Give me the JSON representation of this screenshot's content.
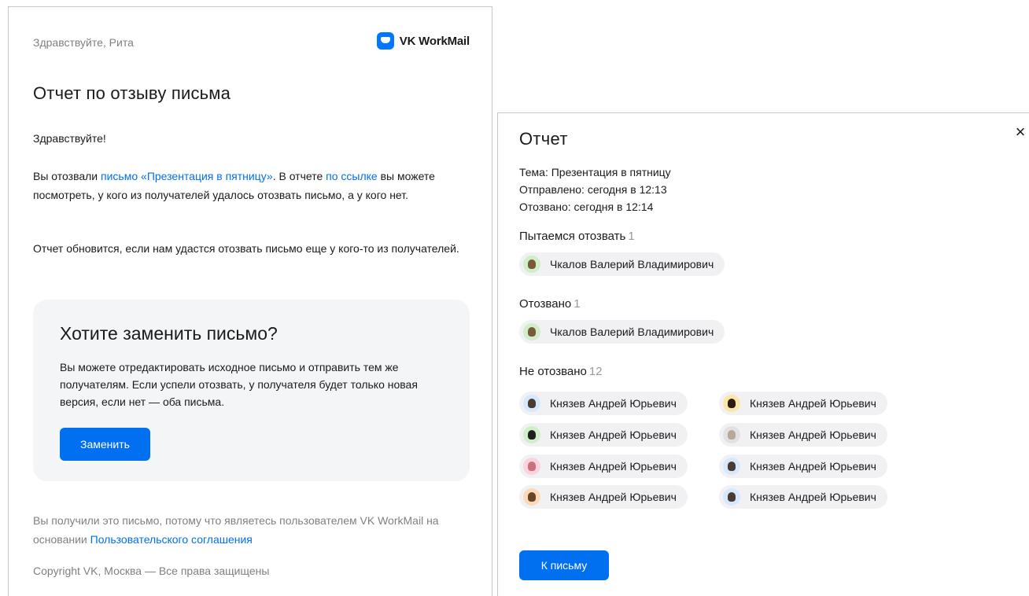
{
  "email": {
    "greeting_top": "Здравствуйте, Рита",
    "brand_name": "VK WorkMail",
    "title": "Отчет по отзыву письма",
    "hello": "Здравствуйте!",
    "para1_prefix": "Вы отозвали ",
    "para1_link": "письмо «Презентация в пятницу»",
    "para1_mid": ". В отчете ",
    "para1_link2": "по ссылке",
    "para1_suffix": " вы можете посмотреть, у кого из получателей удалось отозвать письмо, а у кого нет.",
    "para2": "Отчет обновится, если нам удастся отозвать письмо еще у кого-то из получателей.",
    "replace_card": {
      "title": "Хотите заменить письмо?",
      "text": "Вы можете отредактировать исходное письмо и отправить тем же получателям. Если успели отозвать, у получателя будет только новая версия, если нет — оба письма.",
      "button": "Заменить"
    },
    "footer_prefix": "Вы получили это письмо, потому что являетесь пользователем VK WorkMail на основании ",
    "footer_link": "Пользовательского соглашения",
    "copyright": "Copyright VK, Москва — Все права защищены"
  },
  "report": {
    "title": "Отчет",
    "close_icon": "×",
    "subject": "Тема: Презентация в пятницу",
    "sent": "Отправлено: сегодня в 12:13",
    "recalled_at": "Отозвано: сегодня в 12:14",
    "sections": [
      {
        "label": "Пытаемся отозвать",
        "count": "1",
        "people": [
          {
            "name": "Чкалов Валерий Владимирович",
            "avatar": "av-green"
          }
        ]
      },
      {
        "label": "Отозвано",
        "count": "1",
        "people": [
          {
            "name": "Чкалов Валерий Владимирович",
            "avatar": "av-green"
          }
        ]
      },
      {
        "label": "Не отозвано",
        "count": "12",
        "people": [
          {
            "name": "Князев Андрей Юрьевич",
            "avatar": "av-blue"
          },
          {
            "name": "Князев Андрей Юрьевич",
            "avatar": "av-yellow"
          },
          {
            "name": "Князев Андрей Юрьевич",
            "avatar": "av-mint"
          },
          {
            "name": "Князев Андрей Юрьевич",
            "avatar": "av-gray"
          },
          {
            "name": "Князев Андрей Юрьевич",
            "avatar": "av-pink"
          },
          {
            "name": "Князев Андрей Юрьевич",
            "avatar": "av-blue"
          },
          {
            "name": "Князев Андрей Юрьевич",
            "avatar": "av-orange"
          },
          {
            "name": "Князев Андрей Юрьевич",
            "avatar": "av-blue"
          }
        ]
      }
    ],
    "back_button": "К письму"
  },
  "colors": {
    "accent": "#0070f0",
    "muted_text": "#808080",
    "card_bg": "#f4f5f7",
    "chip_bg": "#f1f1f3"
  }
}
